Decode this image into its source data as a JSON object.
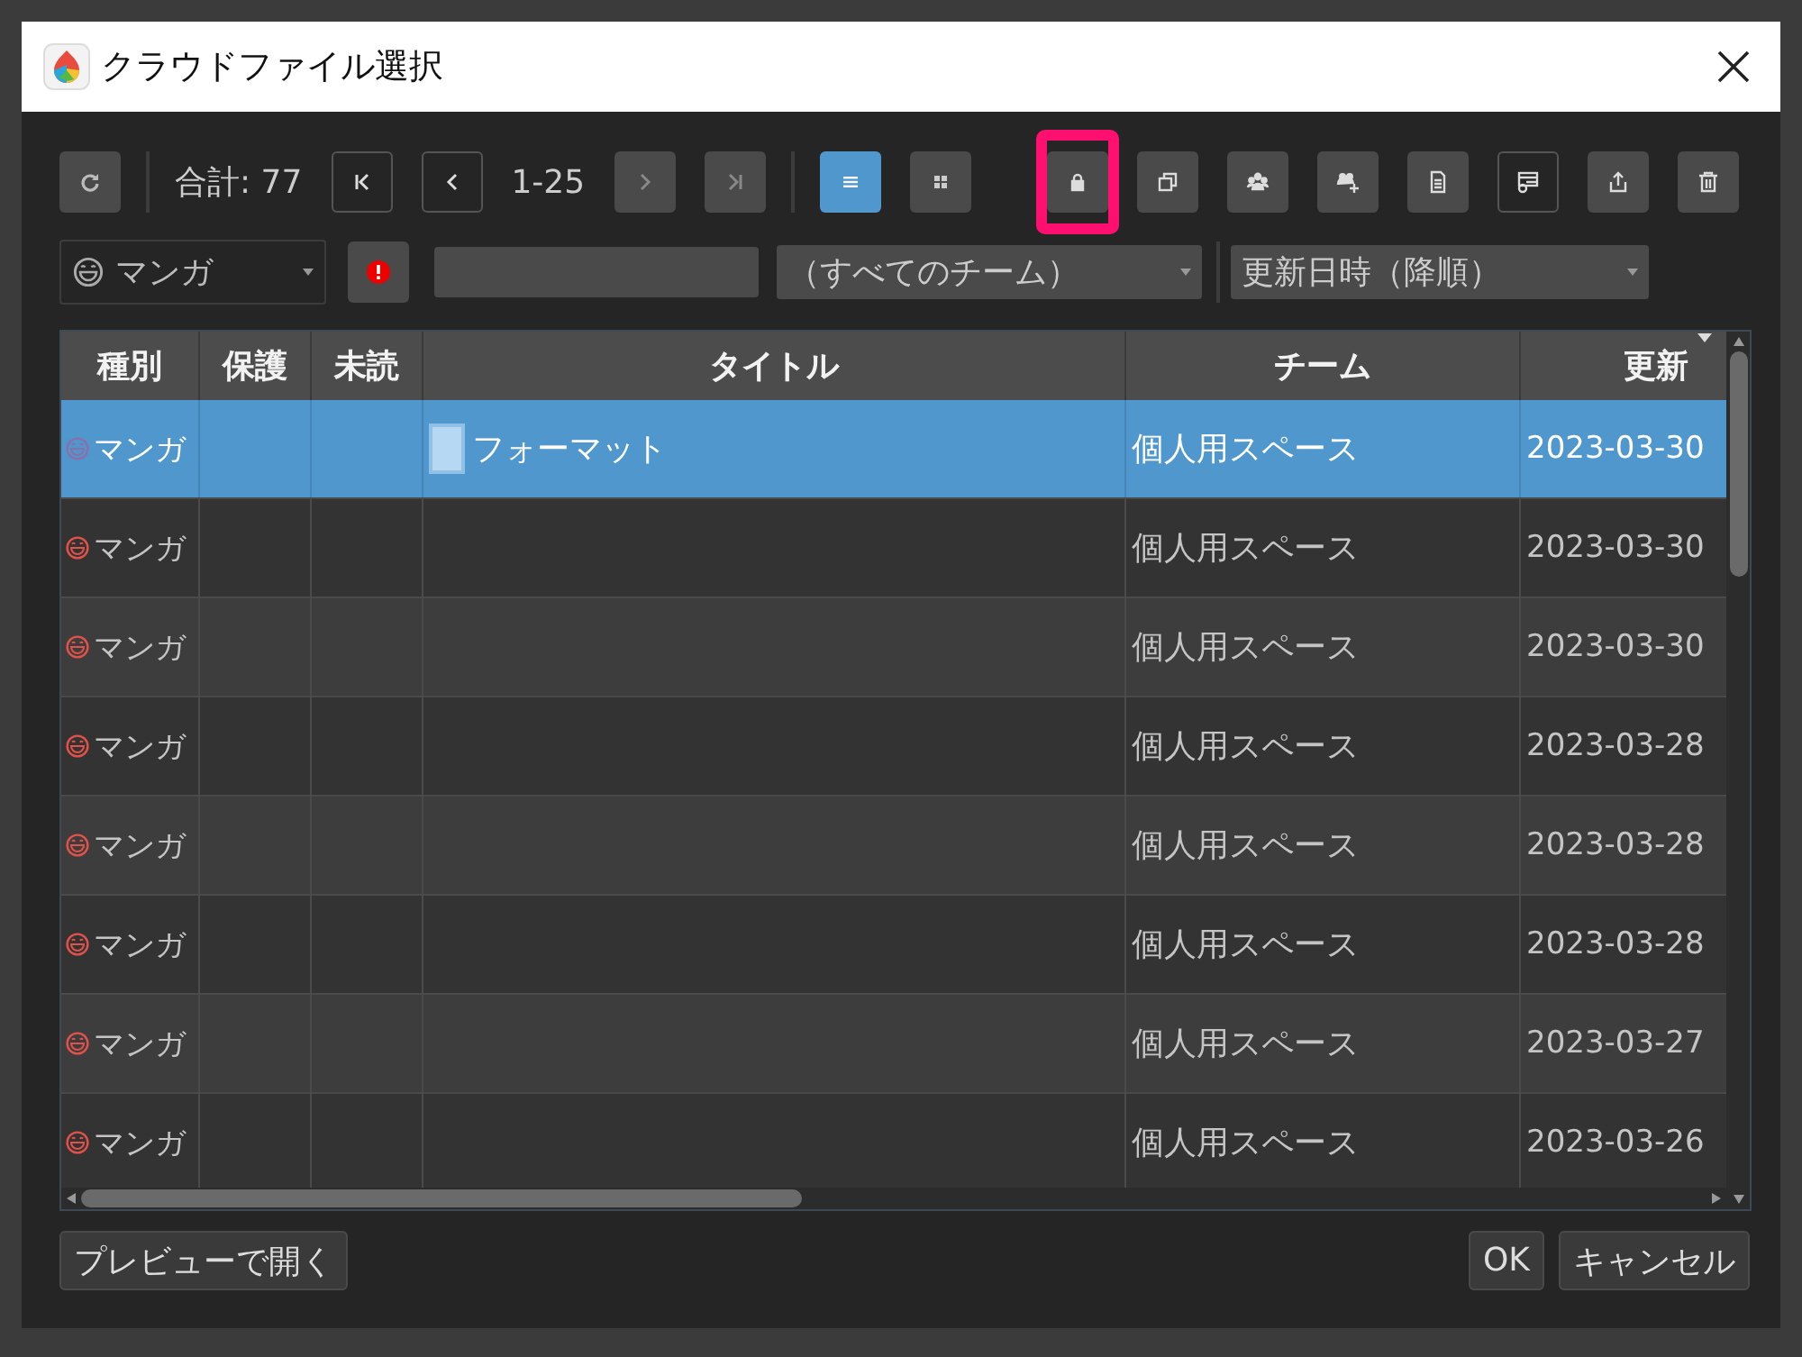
{
  "window": {
    "title": "クラウドファイル選択"
  },
  "toolbar": {
    "total": "合計: 77",
    "range": "1-25",
    "nav_buttons": [
      {
        "kind": "first",
        "disabled": false
      },
      {
        "kind": "prev",
        "disabled": false
      },
      {
        "kind": "next",
        "disabled": true
      },
      {
        "kind": "last",
        "disabled": true
      }
    ],
    "view_buttons": [
      {
        "kind": "list",
        "selected": true
      },
      {
        "kind": "grid",
        "selected": false
      }
    ],
    "action_buttons": [
      {
        "kind": "lock",
        "highlighted": true,
        "pressed": false
      },
      {
        "kind": "copy",
        "highlighted": false,
        "pressed": false
      },
      {
        "kind": "team",
        "highlighted": false,
        "pressed": false
      },
      {
        "kind": "team-add",
        "highlighted": false,
        "pressed": false
      },
      {
        "kind": "document",
        "highlighted": false,
        "pressed": false
      },
      {
        "kind": "form",
        "highlighted": false,
        "pressed": true
      },
      {
        "kind": "share",
        "highlighted": false,
        "pressed": false
      },
      {
        "kind": "trash",
        "highlighted": false,
        "pressed": false
      }
    ]
  },
  "filters": {
    "category": "マンガ",
    "team": "（すべてのチーム）",
    "sort": "更新日時（降順）"
  },
  "table": {
    "columns": [
      "種別",
      "保護",
      "未読",
      "タイトル",
      "チーム",
      "更新"
    ],
    "rows": [
      {
        "type": "マンガ",
        "title": "フォーマット",
        "team": "個人用スペース",
        "updated": "2023-03-30",
        "selected": true
      },
      {
        "type": "マンガ",
        "team": "個人用スペース",
        "updated": "2023-03-30",
        "selected": false
      },
      {
        "type": "マンガ",
        "team": "個人用スペース",
        "updated": "2023-03-30",
        "selected": false
      },
      {
        "type": "マンガ",
        "team": "個人用スペース",
        "updated": "2023-03-28",
        "selected": false
      },
      {
        "type": "マンガ",
        "team": "個人用スペース",
        "updated": "2023-03-28",
        "selected": false
      },
      {
        "type": "マンガ",
        "team": "個人用スペース",
        "updated": "2023-03-28",
        "selected": false
      },
      {
        "type": "マンガ",
        "team": "個人用スペース",
        "updated": "2023-03-27",
        "selected": false
      },
      {
        "type": "マンガ",
        "team": "個人用スペース",
        "updated": "2023-03-26",
        "selected": false
      }
    ]
  },
  "buttons": {
    "preview": "プレビューで開く",
    "ok": "OK",
    "cancel": "キャンセル"
  }
}
